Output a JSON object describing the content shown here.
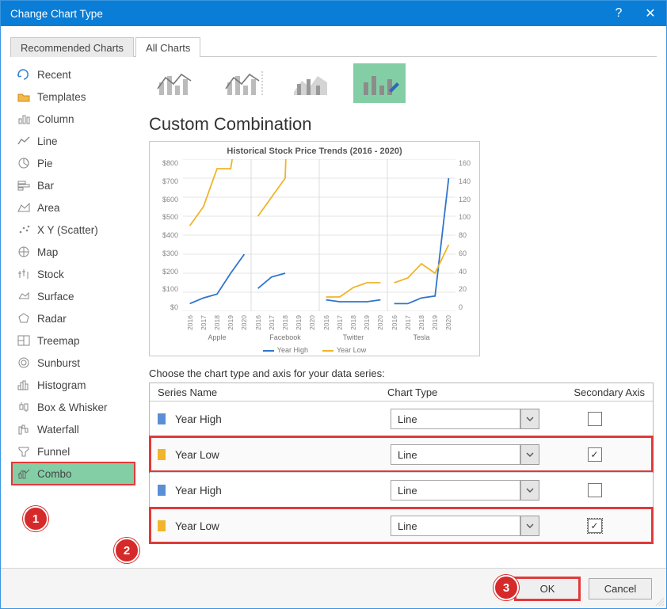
{
  "titlebar": {
    "title": "Change Chart Type",
    "help_icon": "?",
    "close_icon": "✕"
  },
  "tabs": {
    "recommended": "Recommended Charts",
    "all": "All Charts"
  },
  "nav": [
    {
      "icon": "recent",
      "label": "Recent"
    },
    {
      "icon": "templates",
      "label": "Templates"
    },
    {
      "icon": "column",
      "label": "Column"
    },
    {
      "icon": "line",
      "label": "Line"
    },
    {
      "icon": "pie",
      "label": "Pie"
    },
    {
      "icon": "bar",
      "label": "Bar"
    },
    {
      "icon": "area",
      "label": "Area"
    },
    {
      "icon": "scatter",
      "label": "X Y (Scatter)"
    },
    {
      "icon": "map",
      "label": "Map"
    },
    {
      "icon": "stock",
      "label": "Stock"
    },
    {
      "icon": "surface",
      "label": "Surface"
    },
    {
      "icon": "radar",
      "label": "Radar"
    },
    {
      "icon": "treemap",
      "label": "Treemap"
    },
    {
      "icon": "sunburst",
      "label": "Sunburst"
    },
    {
      "icon": "histogram",
      "label": "Histogram"
    },
    {
      "icon": "boxwhisker",
      "label": "Box & Whisker"
    },
    {
      "icon": "waterfall",
      "label": "Waterfall"
    },
    {
      "icon": "funnel",
      "label": "Funnel"
    },
    {
      "icon": "combo",
      "label": "Combo"
    }
  ],
  "heading": "Custom Combination",
  "chart_data": {
    "type": "line",
    "title": "Historical Stock Price Trends (2016 - 2020)",
    "categories_groups": [
      "Apple",
      "Facebook",
      "Twitter",
      "Tesla"
    ],
    "years": [
      "2016",
      "2017",
      "2018",
      "2019",
      "2020"
    ],
    "ylim": [
      0,
      800
    ],
    "y2lim": [
      0,
      160
    ],
    "yticks": [
      "$800",
      "$700",
      "$600",
      "$500",
      "$400",
      "$300",
      "$200",
      "$100",
      "$0"
    ],
    "y2ticks": [
      "160",
      "140",
      "120",
      "100",
      "80",
      "60",
      "40",
      "20",
      "0"
    ],
    "legend": [
      "Year High",
      "Year Low"
    ],
    "series": [
      {
        "name": "Year High",
        "axis": "primary",
        "color": "#2e75cf",
        "values": [
          [
            40,
            70,
            90,
            200,
            300
          ],
          [
            120,
            180,
            200,
            null,
            null
          ],
          [
            60,
            50,
            50,
            50,
            60
          ],
          [
            40,
            40,
            70,
            80,
            700
          ]
        ]
      },
      {
        "name": "Year Low",
        "axis": "secondary",
        "color": "#f0b429",
        "values": [
          [
            90,
            110,
            150,
            150,
            240
          ],
          [
            100,
            120,
            140,
            570,
            690
          ],
          [
            15,
            15,
            25,
            30,
            30
          ],
          [
            30,
            35,
            50,
            40,
            70
          ]
        ]
      }
    ]
  },
  "choose_label": "Choose the chart type and axis for your data series:",
  "series_columns": {
    "name": "Series Name",
    "type": "Chart Type",
    "axis": "Secondary Axis"
  },
  "series_rows": [
    {
      "swatch": "blue",
      "name": "Year High",
      "type": "Line",
      "secondary": false,
      "highlight": false
    },
    {
      "swatch": "yellow",
      "name": "Year Low",
      "type": "Line",
      "secondary": true,
      "highlight": true
    },
    {
      "swatch": "blue",
      "name": "Year High",
      "type": "Line",
      "secondary": false,
      "highlight": false
    },
    {
      "swatch": "yellow",
      "name": "Year Low",
      "type": "Line",
      "secondary": true,
      "highlight": true
    }
  ],
  "footer": {
    "ok": "OK",
    "cancel": "Cancel"
  },
  "callouts": {
    "c1": "1",
    "c2": "2",
    "c3": "3"
  }
}
